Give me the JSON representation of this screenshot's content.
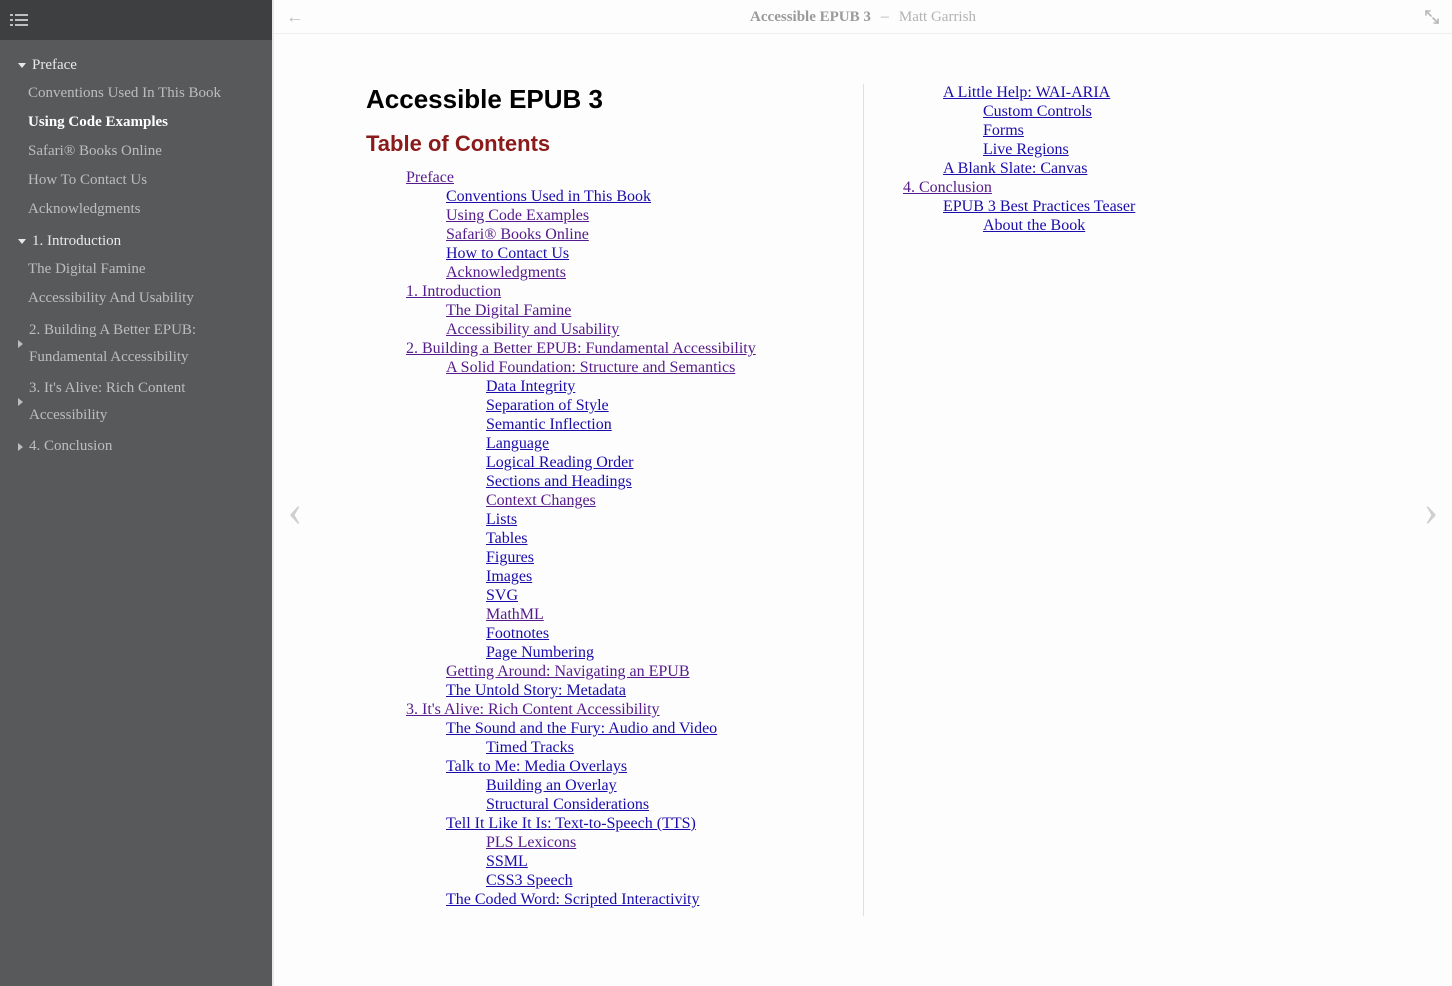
{
  "header": {
    "title": "Accessible EPUB 3",
    "separator": "–",
    "author": "Matt Garrish"
  },
  "sidebar": {
    "sections": [
      {
        "label": "Preface",
        "expanded": true,
        "items": [
          {
            "label": "Conventions Used In This Book",
            "active": false
          },
          {
            "label": "Using Code Examples",
            "active": true
          },
          {
            "label": "Safari® Books Online",
            "active": false
          },
          {
            "label": "How To Contact Us",
            "active": false
          },
          {
            "label": "Acknowledgments",
            "active": false
          }
        ]
      },
      {
        "label": "1. Introduction",
        "expanded": true,
        "items": [
          {
            "label": "The Digital Famine",
            "active": false
          },
          {
            "label": "Accessibility And Usability",
            "active": false
          }
        ]
      },
      {
        "label": "2. Building A Better EPUB: Fundamental Accessibility",
        "expanded": false,
        "items": []
      },
      {
        "label": "3. It's Alive: Rich Content Accessibility",
        "expanded": false,
        "items": []
      },
      {
        "label": "4. Conclusion",
        "expanded": false,
        "items": []
      }
    ]
  },
  "content": {
    "doc_title": "Accessible EPUB 3",
    "toc_heading": "Table of Contents",
    "toc": [
      {
        "label": "Preface",
        "visited": true,
        "children": [
          {
            "label": "Conventions Used in This Book",
            "visited": false
          },
          {
            "label": "Using Code Examples",
            "visited": true
          },
          {
            "label": "Safari® Books Online",
            "visited": true
          },
          {
            "label": "How to Contact Us",
            "visited": false
          },
          {
            "label": "Acknowledgments",
            "visited": true
          }
        ]
      },
      {
        "label": "1. Introduction",
        "visited": true,
        "children": [
          {
            "label": "The Digital Famine",
            "visited": true
          },
          {
            "label": "Accessibility and Usability",
            "visited": true
          }
        ]
      },
      {
        "label": "2. Building a Better EPUB: Fundamental Accessibility",
        "visited": true,
        "children": [
          {
            "label": "A Solid Foundation: Structure and Semantics",
            "visited": true,
            "children": [
              {
                "label": "Data Integrity",
                "visited": false
              },
              {
                "label": "Separation of Style",
                "visited": false
              },
              {
                "label": "Semantic Inflection",
                "visited": false
              },
              {
                "label": "Language",
                "visited": false
              },
              {
                "label": "Logical Reading Order",
                "visited": false
              },
              {
                "label": "Sections and Headings",
                "visited": false
              },
              {
                "label": "Context Changes",
                "visited": true
              },
              {
                "label": "Lists",
                "visited": false
              },
              {
                "label": "Tables",
                "visited": false
              },
              {
                "label": "Figures",
                "visited": false
              },
              {
                "label": "Images",
                "visited": false
              },
              {
                "label": "SVG",
                "visited": false
              },
              {
                "label": "MathML",
                "visited": true
              },
              {
                "label": "Footnotes",
                "visited": false
              },
              {
                "label": "Page Numbering",
                "visited": false
              }
            ]
          },
          {
            "label": "Getting Around: Navigating an EPUB",
            "visited": true
          },
          {
            "label": "The Untold Story: Metadata",
            "visited": false
          }
        ]
      },
      {
        "label": "3. It's Alive: Rich Content Accessibility",
        "visited": true,
        "children": [
          {
            "label": "The Sound and the Fury: Audio and Video",
            "visited": false,
            "children": [
              {
                "label": "Timed Tracks",
                "visited": false
              }
            ]
          },
          {
            "label": "Talk to Me: Media Overlays",
            "visited": false,
            "children": [
              {
                "label": "Building an Overlay",
                "visited": false
              },
              {
                "label": "Structural Considerations",
                "visited": false
              }
            ]
          },
          {
            "label": "Tell It Like It Is: Text-to-Speech (TTS)",
            "visited": false,
            "children": [
              {
                "label": "PLS Lexicons",
                "visited": true
              },
              {
                "label": "SSML",
                "visited": false
              },
              {
                "label": "CSS3 Speech",
                "visited": false
              }
            ]
          },
          {
            "label": "The Coded Word: Scripted Interactivity",
            "visited": false
          },
          {
            "label": "A Little Help: WAI-ARIA",
            "visited": false,
            "children": [
              {
                "label": "Custom Controls",
                "visited": false
              },
              {
                "label": "Forms",
                "visited": false
              },
              {
                "label": "Live Regions",
                "visited": false
              }
            ]
          },
          {
            "label": "A Blank Slate: Canvas",
            "visited": false
          }
        ]
      },
      {
        "label": "4. Conclusion",
        "visited": true,
        "children": [
          {
            "label": "EPUB 3 Best Practices Teaser",
            "visited": false,
            "children": [
              {
                "label": "About the Book",
                "visited": false
              }
            ]
          }
        ]
      }
    ]
  }
}
